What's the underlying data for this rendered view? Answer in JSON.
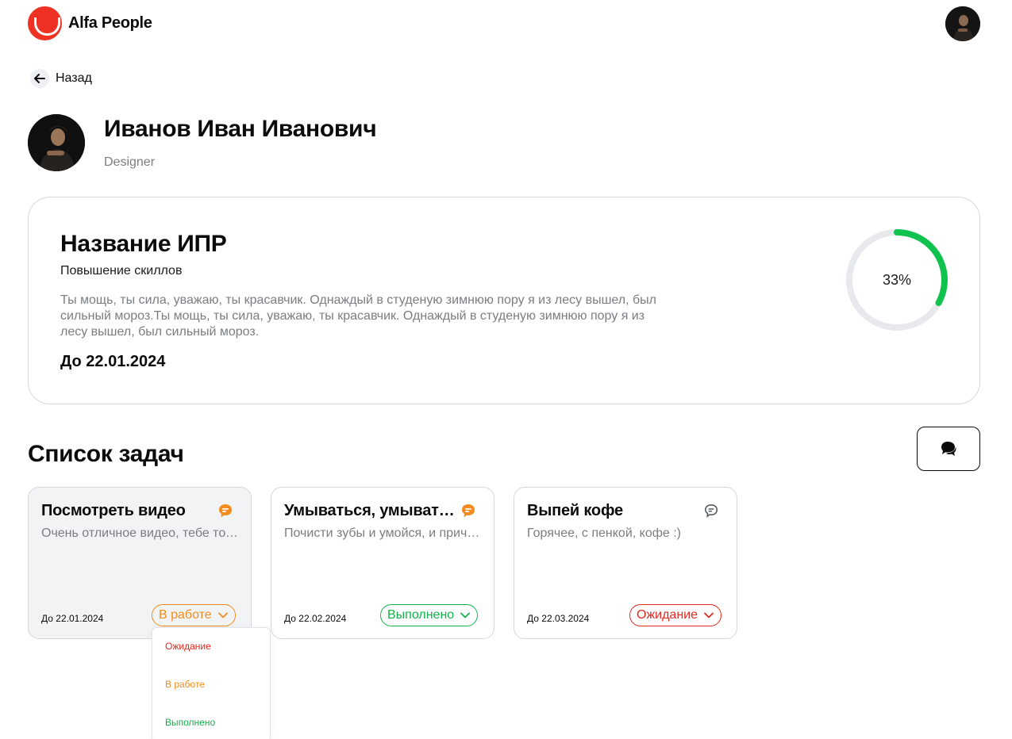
{
  "app": {
    "name": "Alfa People"
  },
  "nav": {
    "back_label": "Назад"
  },
  "profile": {
    "name": "Иванов Иван Иванович",
    "role": "Designer"
  },
  "ipr": {
    "title": "Название ИПР",
    "subtitle": "Повышение скиллов",
    "description": "Ты мощь, ты сила, уважаю, ты красавчик. Однаждый в студеную зимнюю пору я из лесу вышел, был сильный мороз.Ты мощь, ты сила, уважаю, ты красавчик. Однаждый в студеную зимнюю пору я из лесу вышел, был сильный мороз.",
    "deadline": "До 22.01.2024",
    "progress_percent": 33,
    "progress_label": "33%"
  },
  "tasks": {
    "title": "Список задач",
    "items": [
      {
        "title": "Посмотреть видео",
        "description": "Очень отличное видео, тебе точно понравится",
        "deadline": "До 22.01.2024",
        "status": "В работе",
        "status_color": "#f28c1e",
        "comment_icon": "chat-filled-icon",
        "comment_color": "#f28c1e"
      },
      {
        "title": "Умываться, умываться по утрам",
        "description": "Почисти зубы и умойся, и причешись",
        "deadline": "До 22.02.2024",
        "status": "Выполнено",
        "status_color": "#12b34a",
        "comment_icon": "chat-filled-icon",
        "comment_color": "#f28c1e"
      },
      {
        "title": "Выпей кофе",
        "description": "Горячее, с пенкой, кофе :)",
        "deadline": "До 22.03.2024",
        "status": "Ожидание",
        "status_color": "#e5281e",
        "comment_icon": "chat-outline-icon",
        "comment_color": "#555a60"
      }
    ]
  },
  "status_dropdown": {
    "options": [
      {
        "label": "Ожидание",
        "color": "#e5281e"
      },
      {
        "label": "В работе",
        "color": "#f28c1e"
      },
      {
        "label": "Выполнено",
        "color": "#12b34a"
      }
    ]
  },
  "colors": {
    "brand": "#ef3124",
    "progress": "#12c24f",
    "progress_track": "#e8e9ec"
  }
}
